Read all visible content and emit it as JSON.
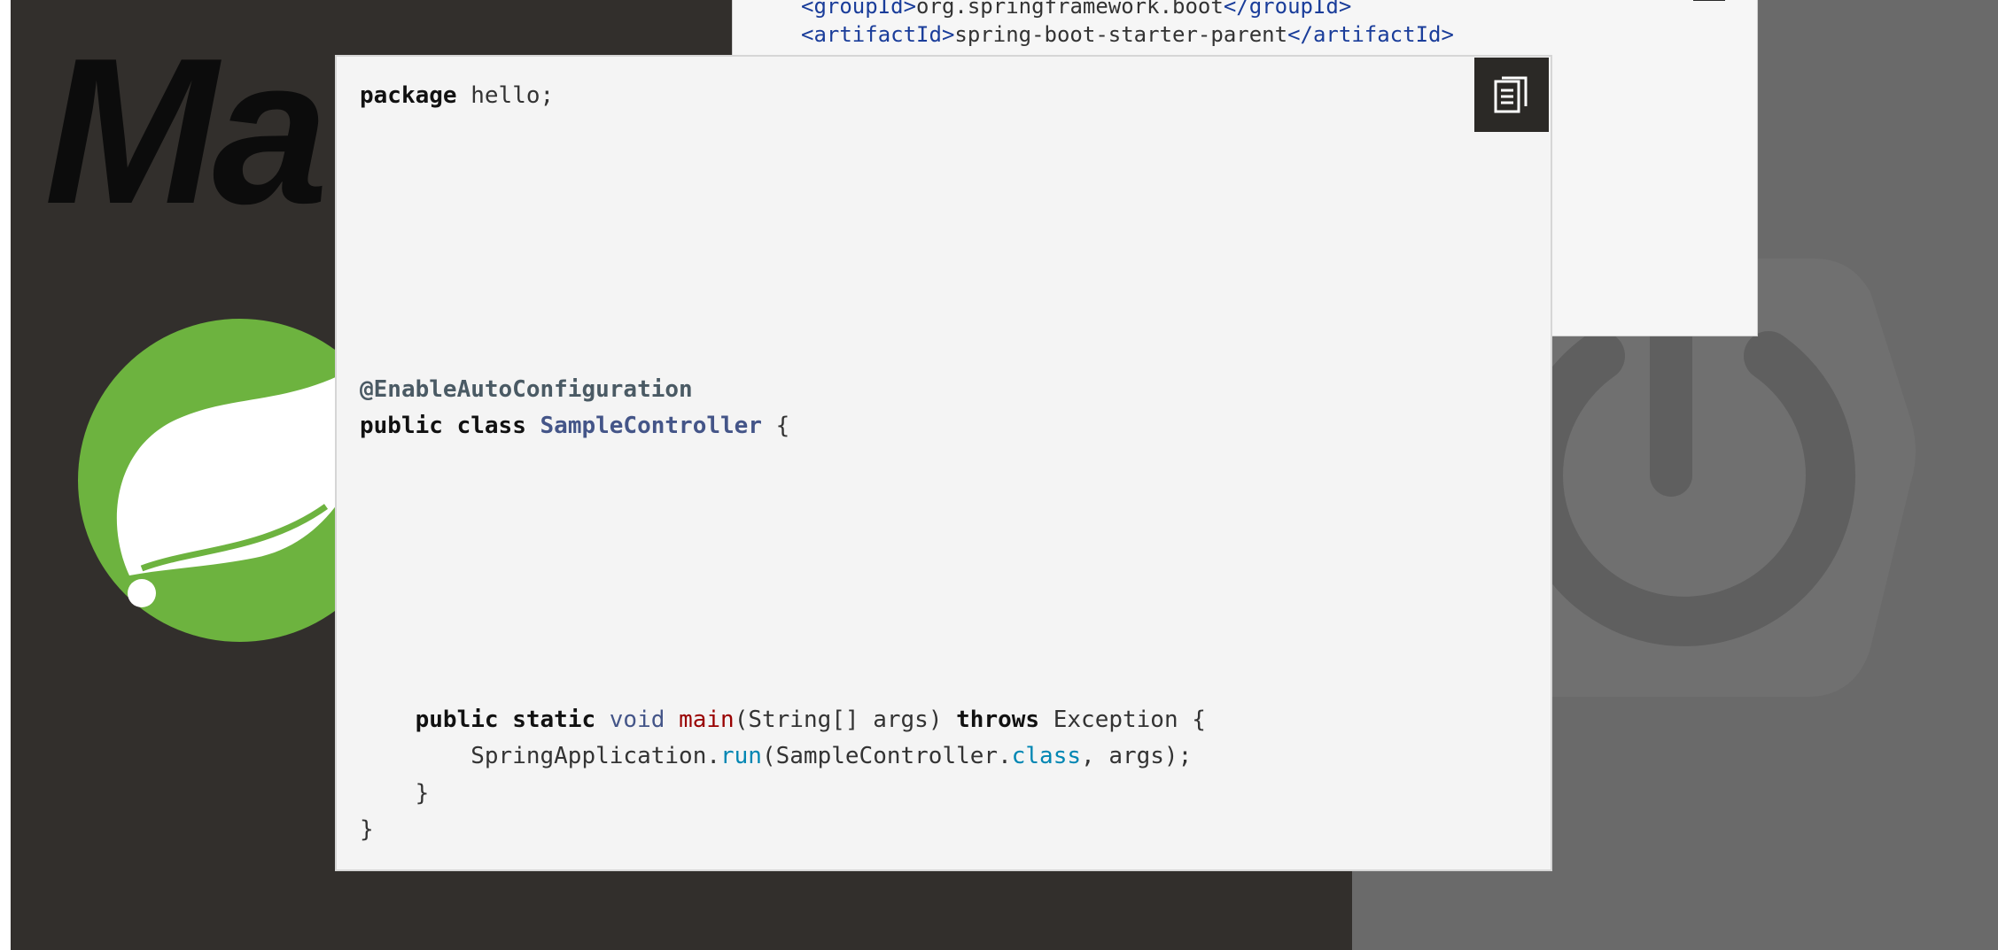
{
  "background": {
    "logo_text": "Ma",
    "colors": {
      "dark": "#322f2c",
      "gray": "#6a6a6a",
      "spring_green": "#6db33f"
    },
    "icons": [
      "spring-leaf-logo",
      "spring-boot-power-icon"
    ]
  },
  "xml_snippet": {
    "lines": [
      {
        "open_tag": "<groupId>",
        "text": "org.springframework.boot",
        "close_tag": "</groupId>"
      },
      {
        "open_tag": "<artifactId>",
        "text": "spring-boot-starter-parent",
        "close_tag": "</artifactId>"
      }
    ]
  },
  "code": {
    "copy_icon": "copy-clipboard-icon",
    "package": {
      "keyword": "package",
      "name": "hello;"
    },
    "annotation": "@EnableAutoConfiguration",
    "class_decl": {
      "kw1": "public",
      "kw2": "class",
      "name": "SampleController",
      "brace": "{"
    },
    "main_decl": {
      "kw1": "public",
      "kw2": "static",
      "type": "void",
      "name": "main",
      "params": "(String[] args)",
      "kw3": "throws",
      "exception": "Exception",
      "brace": "{"
    },
    "run_call": {
      "obj": "SpringApplication.",
      "method": "run",
      "arg_open": "(SampleController.",
      "arg_kw": "class",
      "arg_rest": ", args);"
    },
    "close_inner": "}",
    "close_outer": "}"
  }
}
